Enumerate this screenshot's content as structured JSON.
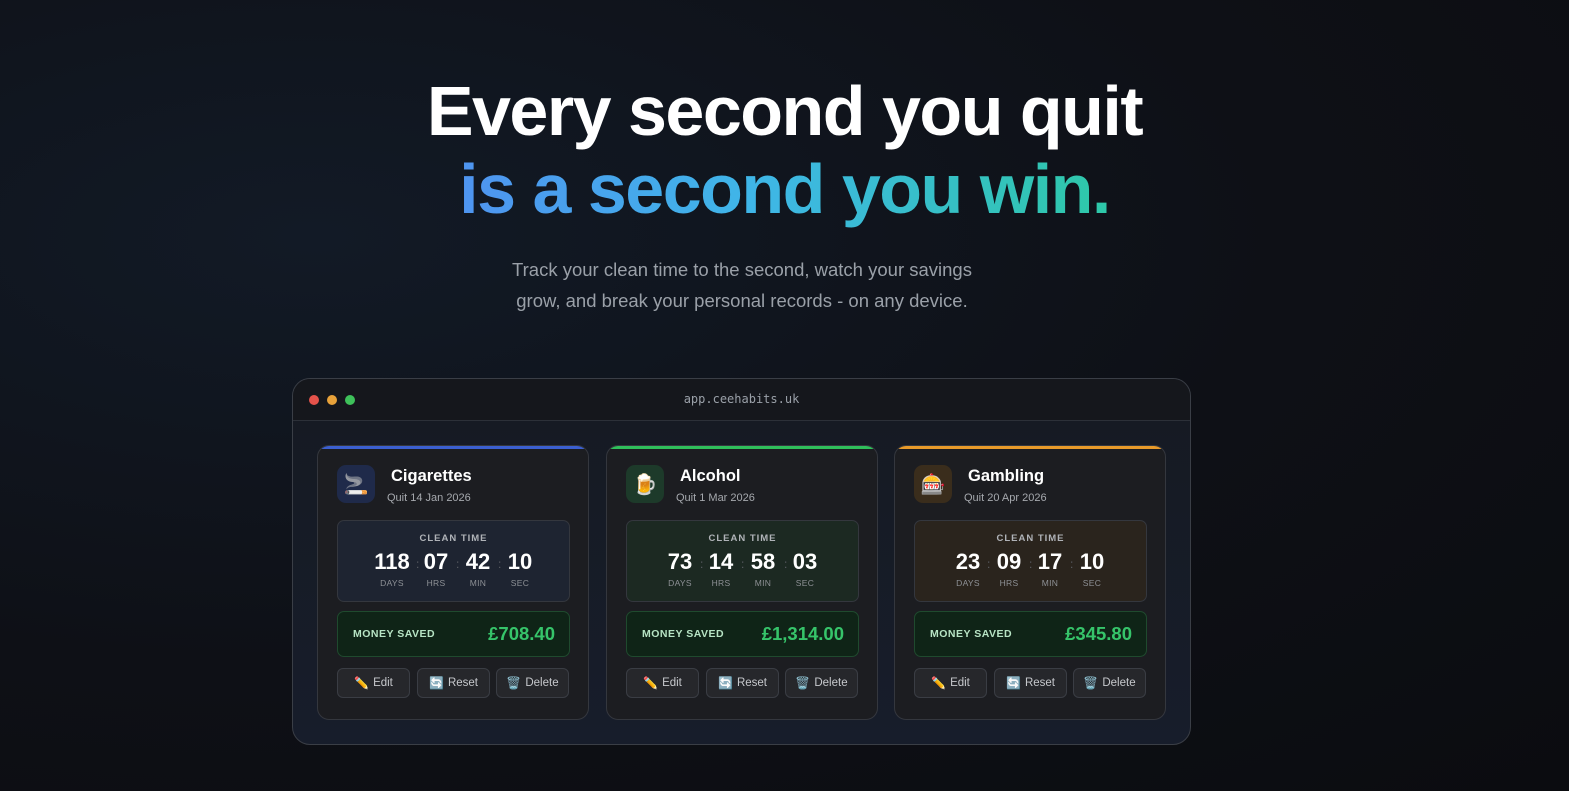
{
  "hero": {
    "line1": "Every second you quit",
    "line2": "is a second you win.",
    "sub_line1": "Track your clean time to the second, watch your savings",
    "sub_line2": "grow, and break your personal records - on any device."
  },
  "window": {
    "url": "app.ceehabits.uk",
    "traffic_lights": [
      "#e5534b",
      "#e8a23a",
      "#3ec15a"
    ]
  },
  "clean_time_label": "CLEAN TIME",
  "unit_labels": {
    "days": "DAYS",
    "hrs": "HRS",
    "min": "MIN",
    "sec": "SEC"
  },
  "money_label": "MONEY SAVED",
  "buttons": {
    "edit": "Edit",
    "reset": "Reset",
    "delete": "Delete"
  },
  "button_icons": {
    "edit": "pencil-icon",
    "reset": "refresh-icon",
    "delete": "trash-icon"
  },
  "cards": [
    {
      "name": "Cigarettes",
      "quit": "Quit 14 Jan 2026",
      "icon": "cigarette-icon",
      "accent": "#3b5fd0",
      "days": "118",
      "hrs": "07",
      "min": "42",
      "sec": "10",
      "saved": "£708.40"
    },
    {
      "name": "Alcohol",
      "quit": "Quit 1 Mar 2026",
      "icon": "beer-icon",
      "accent": "#2fbf5b",
      "days": "73",
      "hrs": "14",
      "min": "58",
      "sec": "03",
      "saved": "£1,314.00"
    },
    {
      "name": "Gambling",
      "quit": "Quit 20 Apr 2026",
      "icon": "slot-machine-icon",
      "accent": "#e89a2a",
      "days": "23",
      "hrs": "09",
      "min": "17",
      "sec": "10",
      "saved": "£345.80"
    }
  ]
}
